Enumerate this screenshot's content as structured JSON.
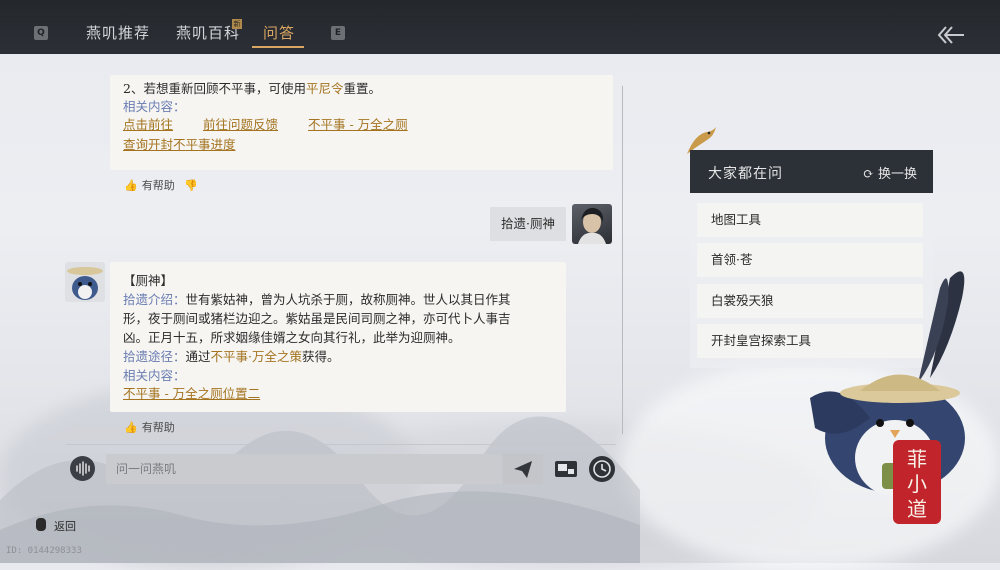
{
  "topbar": {
    "key_left": "Q",
    "key_right": "E",
    "tabs": [
      {
        "label": "燕叽推荐"
      },
      {
        "label": "燕叽百科",
        "badge": "新"
      },
      {
        "label": "问答"
      }
    ]
  },
  "answer1": {
    "partial_line_prefix": "2、若想重新回顾不平事，可使用",
    "partial_line_item": "平尼令",
    "partial_line_suffix": "重置。",
    "related_label": "相关内容：",
    "links": [
      "点击前往",
      "前往问题反馈",
      "不平事 - 万全之厕",
      "查询开封不平事进度"
    ],
    "helpful": "有帮助"
  },
  "user_message": "拾遗·厕神",
  "answer2": {
    "title": "【厕神】",
    "intro_label": "拾遗介绍：",
    "intro_line1": "世有紫姑神，曾为人坑杀于厕，故称厕神。世人以其日作其",
    "intro_line2": "形，夜于厕间或猪栏边迎之。紫姑虽是民间司厕之神，亦可代卜人事吉",
    "intro_line3": "凶。正月十五，所求姻缘佳婿之女向其行礼，此举为迎厕神。",
    "route_label": "拾遗途径：",
    "route_prefix": "通过",
    "route_item": "不平事·万全之策",
    "route_suffix": "获得。",
    "related_label": "相关内容：",
    "link": "不平事 - 万全之厕位置二",
    "helpful": "有帮助"
  },
  "input": {
    "placeholder": "问一问燕叽"
  },
  "panel": {
    "title": "大家都在问",
    "refresh_label": "换一换",
    "questions": [
      "地图工具",
      "首领·苍",
      "白裳殁天狼",
      "开封皇宫探索工具"
    ]
  },
  "mascot": {
    "seal_text": "菲小道"
  },
  "footer": {
    "back_label": "返回",
    "uid": "ID: 0144298333"
  },
  "colors": {
    "accent": "#d9a663",
    "link": "#a4731f",
    "muted_label": "#6a7db2",
    "topbar": "#2a2d32"
  }
}
